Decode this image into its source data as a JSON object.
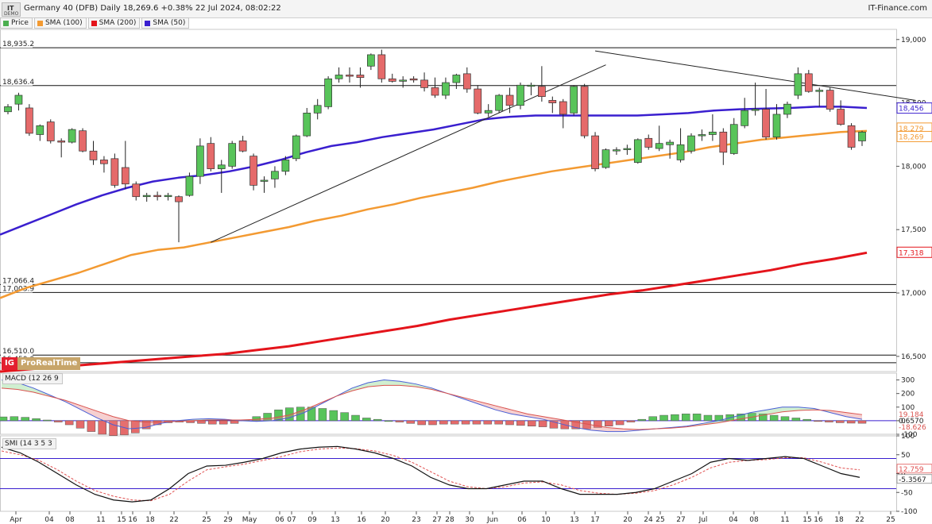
{
  "header": {
    "logo_text": "IT",
    "logo_sub": "DEMO",
    "title": "Germany 40 (DFB) Daily 18,269.6 +0.38% 22 Jul 2024, 08:02:22",
    "brand": "IT-Finance.com"
  },
  "legend": [
    {
      "label": "Price",
      "color": "#4caf50"
    },
    {
      "label": "SMA (100)",
      "color": "#f39a32"
    },
    {
      "label": "SMA (200)",
      "color": "#e4141b"
    },
    {
      "label": "SMA (50)",
      "color": "#3a1fcf"
    }
  ],
  "watermark": {
    "logo": "IG",
    "text": "ProRealTime"
  },
  "panes": {
    "macd_label": "MACD (12 26 9",
    "smi_label": "SMI (14 3 5 3"
  },
  "chart_data": {
    "type": "candlestick",
    "x_tick_labels": [
      "Apr",
      "04",
      "08",
      "11",
      "15",
      "16",
      "18",
      "22",
      "25",
      "29",
      "May",
      "06",
      "07",
      "09",
      "13",
      "16",
      "20",
      "23",
      "27",
      "28",
      "30",
      "Jun",
      "06",
      "10",
      "13",
      "17",
      "20",
      "24",
      "25",
      "27",
      "Jul",
      "04",
      "08",
      "11",
      "15",
      "16",
      "18",
      "22",
      "25"
    ],
    "y_ticks": [
      19000,
      18500,
      18000,
      17500,
      17000,
      16500
    ],
    "ylim": [
      16380,
      19080
    ],
    "price_labels": [
      {
        "value": 18456,
        "text": "18,456",
        "color": "#3a1fcf"
      },
      {
        "value": 18279,
        "text": "18,279",
        "color": "#f39a32"
      },
      {
        "value": 18269,
        "text": "18,269",
        "color": "#f39a32"
      },
      {
        "value": 17318,
        "text": "17,318",
        "color": "#e4141b"
      }
    ],
    "horizontal_levels": [
      {
        "value": 18935.2,
        "text": "18,935.2"
      },
      {
        "value": 18636.4,
        "text": "18,636.4"
      },
      {
        "value": 17066.4,
        "text": "17,066.4"
      },
      {
        "value": 17003.9,
        "text": "17,003.9"
      },
      {
        "value": 16510.0,
        "text": "16,510.0"
      },
      {
        "value": 16450.0,
        "text": "16,450.0"
      }
    ],
    "candles": [
      {
        "o": 18430,
        "h": 18490,
        "l": 18410,
        "c": 18470
      },
      {
        "o": 18490,
        "h": 18580,
        "l": 18440,
        "c": 18560
      },
      {
        "o": 18460,
        "h": 18490,
        "l": 18240,
        "c": 18260
      },
      {
        "o": 18250,
        "h": 18330,
        "l": 18200,
        "c": 18320
      },
      {
        "o": 18350,
        "h": 18370,
        "l": 18180,
        "c": 18200
      },
      {
        "o": 18200,
        "h": 18220,
        "l": 18070,
        "c": 18190
      },
      {
        "o": 18190,
        "h": 18300,
        "l": 18180,
        "c": 18290
      },
      {
        "o": 18280,
        "h": 18300,
        "l": 18110,
        "c": 18120
      },
      {
        "o": 18120,
        "h": 18200,
        "l": 18010,
        "c": 18050
      },
      {
        "o": 18050,
        "h": 18080,
        "l": 17950,
        "c": 18020
      },
      {
        "o": 18060,
        "h": 18100,
        "l": 17830,
        "c": 17850
      },
      {
        "o": 17990,
        "h": 18200,
        "l": 17820,
        "c": 17860
      },
      {
        "o": 17860,
        "h": 17880,
        "l": 17730,
        "c": 17760
      },
      {
        "o": 17760,
        "h": 17790,
        "l": 17720,
        "c": 17770
      },
      {
        "o": 17770,
        "h": 17800,
        "l": 17730,
        "c": 17760
      },
      {
        "o": 17760,
        "h": 17790,
        "l": 17730,
        "c": 17770
      },
      {
        "o": 17760,
        "h": 17770,
        "l": 17400,
        "c": 17720
      },
      {
        "o": 17770,
        "h": 17950,
        "l": 17760,
        "c": 17920
      },
      {
        "o": 17920,
        "h": 18220,
        "l": 17860,
        "c": 18160
      },
      {
        "o": 18180,
        "h": 18230,
        "l": 17960,
        "c": 17980
      },
      {
        "o": 17980,
        "h": 18050,
        "l": 17790,
        "c": 18010
      },
      {
        "o": 18000,
        "h": 18200,
        "l": 17980,
        "c": 18180
      },
      {
        "o": 18200,
        "h": 18240,
        "l": 18110,
        "c": 18120
      },
      {
        "o": 18080,
        "h": 18100,
        "l": 17810,
        "c": 17850
      },
      {
        "o": 17890,
        "h": 17920,
        "l": 17790,
        "c": 17890
      },
      {
        "o": 17900,
        "h": 18000,
        "l": 17830,
        "c": 17960
      },
      {
        "o": 17960,
        "h": 18080,
        "l": 17930,
        "c": 18050
      },
      {
        "o": 18060,
        "h": 18250,
        "l": 18040,
        "c": 18240
      },
      {
        "o": 18240,
        "h": 18460,
        "l": 18230,
        "c": 18420
      },
      {
        "o": 18420,
        "h": 18530,
        "l": 18370,
        "c": 18480
      },
      {
        "o": 18470,
        "h": 18710,
        "l": 18450,
        "c": 18690
      },
      {
        "o": 18690,
        "h": 18780,
        "l": 18660,
        "c": 18720
      },
      {
        "o": 18720,
        "h": 18780,
        "l": 18660,
        "c": 18710
      },
      {
        "o": 18720,
        "h": 18780,
        "l": 18620,
        "c": 18700
      },
      {
        "o": 18790,
        "h": 18890,
        "l": 18760,
        "c": 18880
      },
      {
        "o": 18880,
        "h": 18920,
        "l": 18660,
        "c": 18690
      },
      {
        "o": 18690,
        "h": 18730,
        "l": 18660,
        "c": 18670
      },
      {
        "o": 18680,
        "h": 18710,
        "l": 18620,
        "c": 18680
      },
      {
        "o": 18690,
        "h": 18710,
        "l": 18660,
        "c": 18680
      },
      {
        "o": 18680,
        "h": 18740,
        "l": 18590,
        "c": 18620
      },
      {
        "o": 18620,
        "h": 18700,
        "l": 18540,
        "c": 18560
      },
      {
        "o": 18560,
        "h": 18700,
        "l": 18530,
        "c": 18660
      },
      {
        "o": 18660,
        "h": 18730,
        "l": 18610,
        "c": 18720
      },
      {
        "o": 18730,
        "h": 18780,
        "l": 18580,
        "c": 18610
      },
      {
        "o": 18610,
        "h": 18640,
        "l": 18410,
        "c": 18420
      },
      {
        "o": 18420,
        "h": 18490,
        "l": 18390,
        "c": 18440
      },
      {
        "o": 18440,
        "h": 18570,
        "l": 18420,
        "c": 18560
      },
      {
        "o": 18560,
        "h": 18620,
        "l": 18420,
        "c": 18480
      },
      {
        "o": 18480,
        "h": 18660,
        "l": 18450,
        "c": 18640
      },
      {
        "o": 18640,
        "h": 18660,
        "l": 18560,
        "c": 18640
      },
      {
        "o": 18630,
        "h": 18790,
        "l": 18510,
        "c": 18550
      },
      {
        "o": 18520,
        "h": 18550,
        "l": 18420,
        "c": 18500
      },
      {
        "o": 18510,
        "h": 18530,
        "l": 18300,
        "c": 18410
      },
      {
        "o": 18420,
        "h": 18640,
        "l": 18400,
        "c": 18630
      },
      {
        "o": 18630,
        "h": 18650,
        "l": 18220,
        "c": 18240
      },
      {
        "o": 18240,
        "h": 18270,
        "l": 17960,
        "c": 17980
      },
      {
        "o": 17990,
        "h": 18140,
        "l": 17980,
        "c": 18130
      },
      {
        "o": 18130,
        "h": 18150,
        "l": 18090,
        "c": 18130
      },
      {
        "o": 18140,
        "h": 18170,
        "l": 18090,
        "c": 18140
      },
      {
        "o": 18030,
        "h": 18220,
        "l": 18020,
        "c": 18210
      },
      {
        "o": 18220,
        "h": 18250,
        "l": 18130,
        "c": 18150
      },
      {
        "o": 18140,
        "h": 18320,
        "l": 18120,
        "c": 18180
      },
      {
        "o": 18170,
        "h": 18210,
        "l": 18060,
        "c": 18190
      },
      {
        "o": 18050,
        "h": 18300,
        "l": 18030,
        "c": 18170
      },
      {
        "o": 18120,
        "h": 18260,
        "l": 18100,
        "c": 18240
      },
      {
        "o": 18240,
        "h": 18290,
        "l": 18200,
        "c": 18250
      },
      {
        "o": 18250,
        "h": 18410,
        "l": 18200,
        "c": 18270
      },
      {
        "o": 18270,
        "h": 18300,
        "l": 18010,
        "c": 18110
      },
      {
        "o": 18100,
        "h": 18380,
        "l": 18090,
        "c": 18330
      },
      {
        "o": 18320,
        "h": 18540,
        "l": 18300,
        "c": 18440
      },
      {
        "o": 18440,
        "h": 18660,
        "l": 18400,
        "c": 18450
      },
      {
        "o": 18450,
        "h": 18610,
        "l": 18210,
        "c": 18230
      },
      {
        "o": 18230,
        "h": 18490,
        "l": 18210,
        "c": 18410
      },
      {
        "o": 18410,
        "h": 18510,
        "l": 18380,
        "c": 18490
      },
      {
        "o": 18560,
        "h": 18780,
        "l": 18530,
        "c": 18730
      },
      {
        "o": 18730,
        "h": 18760,
        "l": 18580,
        "c": 18590
      },
      {
        "o": 18590,
        "h": 18620,
        "l": 18470,
        "c": 18600
      },
      {
        "o": 18600,
        "h": 18620,
        "l": 18430,
        "c": 18450
      },
      {
        "o": 18450,
        "h": 18520,
        "l": 18320,
        "c": 18330
      },
      {
        "o": 18320,
        "h": 18340,
        "l": 18130,
        "c": 18150
      },
      {
        "o": 18200,
        "h": 18280,
        "l": 18160,
        "c": 18270
      }
    ],
    "sma_50": [
      17460,
      17540,
      17620,
      17700,
      17770,
      17830,
      17880,
      17910,
      17930,
      17960,
      18000,
      18050,
      18110,
      18160,
      18190,
      18230,
      18260,
      18290,
      18330,
      18370,
      18390,
      18400,
      18400,
      18400,
      18400,
      18400,
      18410,
      18420,
      18440,
      18450,
      18455,
      18460,
      18470,
      18470,
      18460
    ],
    "sma_100": [
      16960,
      17040,
      17100,
      17160,
      17230,
      17300,
      17340,
      17360,
      17400,
      17440,
      17480,
      17520,
      17570,
      17610,
      17660,
      17700,
      17750,
      17790,
      17830,
      17880,
      17920,
      17960,
      17990,
      18020,
      18050,
      18080,
      18110,
      18150,
      18180,
      18210,
      18230,
      18250,
      18270,
      18279
    ],
    "sma_200": [
      16380,
      16400,
      16420,
      16440,
      16460,
      16480,
      16500,
      16520,
      16550,
      16580,
      16620,
      16660,
      16700,
      16740,
      16790,
      16830,
      16870,
      16910,
      16950,
      16990,
      17020,
      17060,
      17100,
      17140,
      17180,
      17230,
      17270,
      17318
    ],
    "trendlines": [
      {
        "from": [
          19,
          17400
        ],
        "to": [
          56,
          18800
        ]
      },
      {
        "from": [
          55,
          18910
        ],
        "to": [
          85,
          18520
        ]
      }
    ],
    "macd": {
      "ylim": [
        -100,
        350
      ],
      "y_ticks": [
        300,
        200,
        100,
        0,
        -100
      ],
      "labels": [
        "19.184",
        "0.6570",
        "-18.626"
      ],
      "histogram": [
        28,
        30,
        25,
        15,
        5,
        -10,
        -30,
        -55,
        -80,
        -100,
        -110,
        -105,
        -90,
        -60,
        -30,
        -15,
        -10,
        -15,
        -20,
        -25,
        -25,
        -20,
        5,
        30,
        55,
        80,
        95,
        100,
        100,
        90,
        75,
        60,
        40,
        20,
        10,
        0,
        -10,
        -20,
        -30,
        -30,
        -25,
        -25,
        -25,
        -25,
        -25,
        -25,
        -30,
        -35,
        -40,
        -45,
        -55,
        -60,
        -60,
        -60,
        -50,
        -40,
        -30,
        -10,
        10,
        30,
        40,
        45,
        50,
        50,
        40,
        40,
        45,
        50,
        55,
        50,
        40,
        30,
        20,
        10,
        -5,
        -10,
        -15,
        -18,
        -19
      ],
      "macd_line": [
        300,
        280,
        240,
        190,
        140,
        80,
        20,
        -30,
        -60,
        -50,
        -20,
        0,
        10,
        15,
        10,
        0,
        -5,
        0,
        20,
        60,
        120,
        180,
        240,
        280,
        300,
        290,
        270,
        240,
        200,
        160,
        120,
        80,
        50,
        30,
        10,
        -20,
        -50,
        -70,
        -80,
        -80,
        -70,
        -60,
        -50,
        -40,
        -20,
        0,
        30,
        60,
        80,
        100,
        100,
        90,
        60,
        30,
        10
      ],
      "signal_line": [
        240,
        230,
        210,
        180,
        150,
        110,
        70,
        30,
        0,
        -10,
        -10,
        -5,
        0,
        5,
        5,
        5,
        10,
        20,
        40,
        80,
        130,
        180,
        220,
        250,
        260,
        260,
        250,
        230,
        200,
        170,
        140,
        110,
        80,
        50,
        30,
        10,
        -10,
        -30,
        -50,
        -60,
        -65,
        -60,
        -55,
        -45,
        -30,
        -15,
        5,
        25,
        45,
        65,
        75,
        80,
        75,
        60,
        45
      ]
    },
    "smi": {
      "ylim": [
        -100,
        100
      ],
      "y_ticks": [
        100,
        50,
        0,
        -50,
        -100
      ],
      "levels": [
        40,
        -40
      ],
      "labels": [
        "12.759",
        "-5.3567"
      ],
      "smi_line": [
        70,
        55,
        30,
        0,
        -30,
        -55,
        -70,
        -75,
        -70,
        -40,
        0,
        20,
        22,
        30,
        40,
        55,
        65,
        70,
        72,
        65,
        55,
        40,
        20,
        -10,
        -30,
        -40,
        -40,
        -30,
        -20,
        -20,
        -40,
        -55,
        -55,
        -55,
        -50,
        -40,
        -20,
        0,
        30,
        40,
        35,
        40,
        45,
        40,
        20,
        0,
        -10
      ],
      "signal_line": [
        60,
        50,
        35,
        10,
        -20,
        -45,
        -60,
        -70,
        -72,
        -55,
        -20,
        10,
        18,
        25,
        35,
        45,
        58,
        65,
        68,
        66,
        60,
        48,
        30,
        5,
        -20,
        -35,
        -40,
        -35,
        -25,
        -22,
        -30,
        -45,
        -52,
        -55,
        -52,
        -45,
        -30,
        -10,
        15,
        30,
        35,
        37,
        42,
        42,
        30,
        15,
        10
      ]
    }
  }
}
